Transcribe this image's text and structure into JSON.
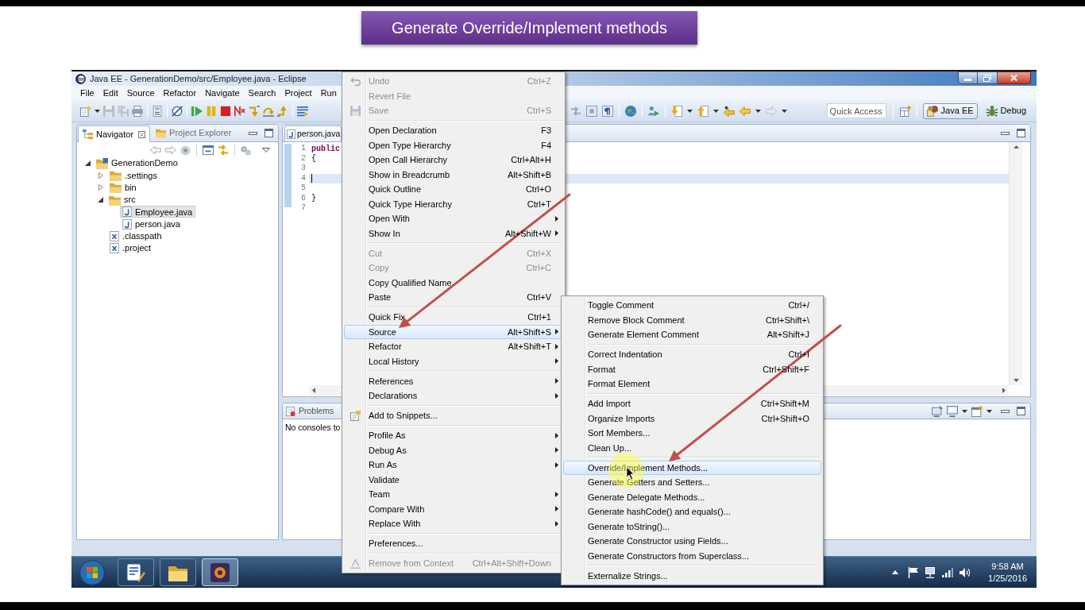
{
  "banner": {
    "title": "Generate Override/Implement methods"
  },
  "window": {
    "title": "Java EE - GenerationDemo/src/Employee.java - Eclipse"
  },
  "menu_bar": [
    "File",
    "Edit",
    "Source",
    "Refactor",
    "Navigate",
    "Search",
    "Project",
    "Run"
  ],
  "toolbar": {
    "quick_access": {
      "placeholder": "Quick Access"
    },
    "perspectives": [
      {
        "label": "Java EE",
        "selected": true
      },
      {
        "label": "Debug",
        "selected": false
      }
    ]
  },
  "navigator": {
    "tabs": [
      {
        "label": "Navigator",
        "selected": true
      },
      {
        "label": "Project Explorer",
        "selected": false
      }
    ],
    "tree": [
      {
        "label": "GenerationDemo",
        "kind": "project",
        "expanded": true,
        "selected": false,
        "children": [
          {
            "label": ".settings",
            "kind": "folder",
            "expanded": false,
            "selected": false
          },
          {
            "label": "bin",
            "kind": "folder",
            "expanded": false,
            "selected": false
          },
          {
            "label": "src",
            "kind": "folder",
            "expanded": true,
            "selected": false,
            "children": [
              {
                "label": "Employee.java",
                "kind": "java",
                "selected": true
              },
              {
                "label": "person.java",
                "kind": "java",
                "selected": false
              }
            ]
          },
          {
            "label": ".classpath",
            "kind": "xml",
            "selected": false
          },
          {
            "label": ".project",
            "kind": "xml",
            "selected": false
          }
        ]
      }
    ]
  },
  "editor": {
    "tabs": [
      {
        "label": "person.java"
      }
    ],
    "lines": [
      {
        "number": "1",
        "tokens": [
          {
            "text": "public",
            "kind": "keyword"
          }
        ],
        "current": false
      },
      {
        "number": "2",
        "tokens": [
          {
            "text": "{",
            "kind": "plain"
          }
        ],
        "current": false
      },
      {
        "number": "3",
        "current": false
      },
      {
        "number": "4",
        "current": true
      },
      {
        "number": "5",
        "current": false
      },
      {
        "number": "6",
        "tokens": [
          {
            "text": "}",
            "kind": "plain"
          }
        ],
        "current": false
      },
      {
        "number": "7",
        "current": false
      }
    ]
  },
  "console": {
    "tabs": [
      {
        "label": "Problems"
      }
    ],
    "message": "No consoles to"
  },
  "context_menu": {
    "groups": [
      {
        "items": [
          {
            "label": "Undo",
            "shortcut": "Ctrl+Z",
            "disabled": true,
            "submenu": false,
            "selected": false
          },
          {
            "label": "Revert File",
            "disabled": true,
            "submenu": false,
            "selected": false
          },
          {
            "label": "Save",
            "shortcut": "Ctrl+S",
            "disabled": true,
            "submenu": false,
            "selected": false
          }
        ]
      },
      {
        "items": [
          {
            "label": "Open Declaration",
            "shortcut": "F3",
            "disabled": false,
            "submenu": false,
            "selected": false
          },
          {
            "label": "Open Type Hierarchy",
            "shortcut": "F4",
            "disabled": false,
            "submenu": false,
            "selected": false
          },
          {
            "label": "Open Call Hierarchy",
            "shortcut": "Ctrl+Alt+H",
            "disabled": false,
            "submenu": false,
            "selected": false
          },
          {
            "label": "Show in Breadcrumb",
            "shortcut": "Alt+Shift+B",
            "disabled": false,
            "submenu": false,
            "selected": false
          },
          {
            "label": "Quick Outline",
            "shortcut": "Ctrl+O",
            "disabled": false,
            "submenu": false,
            "selected": false
          },
          {
            "label": "Quick Type Hierarchy",
            "shortcut": "Ctrl+T",
            "disabled": false,
            "submenu": false,
            "selected": false
          },
          {
            "label": "Open With",
            "disabled": false,
            "submenu": true,
            "selected": false
          },
          {
            "label": "Show In",
            "shortcut": "Alt+Shift+W",
            "disabled": false,
            "submenu": true,
            "selected": false
          }
        ]
      },
      {
        "items": [
          {
            "label": "Cut",
            "shortcut": "Ctrl+X",
            "disabled": true,
            "submenu": false,
            "selected": false
          },
          {
            "label": "Copy",
            "shortcut": "Ctrl+C",
            "disabled": true,
            "submenu": false,
            "selected": false
          },
          {
            "label": "Copy Qualified Name",
            "disabled": false,
            "submenu": false,
            "selected": false
          },
          {
            "label": "Paste",
            "shortcut": "Ctrl+V",
            "disabled": false,
            "submenu": false,
            "selected": false
          }
        ]
      },
      {
        "items": [
          {
            "label": "Quick Fix",
            "shortcut": "Ctrl+1",
            "disabled": false,
            "submenu": false,
            "selected": false
          },
          {
            "label": "Source",
            "shortcut": "Alt+Shift+S",
            "disabled": false,
            "submenu": true,
            "selected": true
          },
          {
            "label": "Refactor",
            "shortcut": "Alt+Shift+T",
            "disabled": false,
            "submenu": true,
            "selected": false
          },
          {
            "label": "Local History",
            "disabled": false,
            "submenu": true,
            "selected": false
          }
        ]
      },
      {
        "items": [
          {
            "label": "References",
            "disabled": false,
            "submenu": true,
            "selected": false
          },
          {
            "label": "Declarations",
            "disabled": false,
            "submenu": true,
            "selected": false
          }
        ]
      },
      {
        "items": [
          {
            "label": "Add to Snippets...",
            "disabled": false,
            "submenu": false,
            "selected": false
          }
        ]
      },
      {
        "items": [
          {
            "label": "Profile As",
            "disabled": false,
            "submenu": true,
            "selected": false
          },
          {
            "label": "Debug As",
            "disabled": false,
            "submenu": true,
            "selected": false
          },
          {
            "label": "Run As",
            "disabled": false,
            "submenu": true,
            "selected": false
          },
          {
            "label": "Validate",
            "disabled": false,
            "submenu": false,
            "selected": false
          },
          {
            "label": "Team",
            "disabled": false,
            "submenu": true,
            "selected": false
          },
          {
            "label": "Compare With",
            "disabled": false,
            "submenu": true,
            "selected": false
          },
          {
            "label": "Replace With",
            "disabled": false,
            "submenu": true,
            "selected": false
          }
        ]
      },
      {
        "items": [
          {
            "label": "Preferences...",
            "disabled": false,
            "submenu": false,
            "selected": false
          }
        ]
      },
      {
        "items": [
          {
            "label": "Remove from Context",
            "shortcut": "Ctrl+Alt+Shift+Down",
            "disabled": true,
            "submenu": false,
            "selected": false
          }
        ]
      }
    ]
  },
  "source_submenu": {
    "groups": [
      {
        "items": [
          {
            "label": "Toggle Comment",
            "shortcut": "Ctrl+/",
            "selected": false
          },
          {
            "label": "Remove Block Comment",
            "shortcut": "Ctrl+Shift+\\",
            "selected": false
          },
          {
            "label": "Generate Element Comment",
            "shortcut": "Alt+Shift+J",
            "selected": false
          }
        ]
      },
      {
        "items": [
          {
            "label": "Correct Indentation",
            "shortcut": "Ctrl+I",
            "selected": false
          },
          {
            "label": "Format",
            "shortcut": "Ctrl+Shift+F",
            "selected": false
          },
          {
            "label": "Format Element",
            "selected": false
          }
        ]
      },
      {
        "items": [
          {
            "label": "Add Import",
            "shortcut": "Ctrl+Shift+M",
            "selected": false
          },
          {
            "label": "Organize Imports",
            "shortcut": "Ctrl+Shift+O",
            "selected": false
          },
          {
            "label": "Sort Members...",
            "selected": false
          },
          {
            "label": "Clean Up...",
            "selected": false
          }
        ]
      },
      {
        "items": [
          {
            "label": "Override/Implement Methods...",
            "selected": true
          },
          {
            "label": "Generate Getters and Setters...",
            "selected": false
          },
          {
            "label": "Generate Delegate Methods...",
            "selected": false
          },
          {
            "label": "Generate hashCode() and equals()...",
            "selected": false
          },
          {
            "label": "Generate toString()...",
            "selected": false
          },
          {
            "label": "Generate Constructor using Fields...",
            "selected": false
          },
          {
            "label": "Generate Constructors from Superclass...",
            "selected": false
          }
        ]
      },
      {
        "items": [
          {
            "label": "Externalize Strings...",
            "selected": false
          }
        ]
      }
    ]
  },
  "taskbar": {
    "apps": [
      {
        "active": false
      },
      {
        "active": false
      },
      {
        "active": true
      }
    ],
    "clock": {
      "time": "9:58 AM",
      "date": "1/25/2016"
    }
  }
}
